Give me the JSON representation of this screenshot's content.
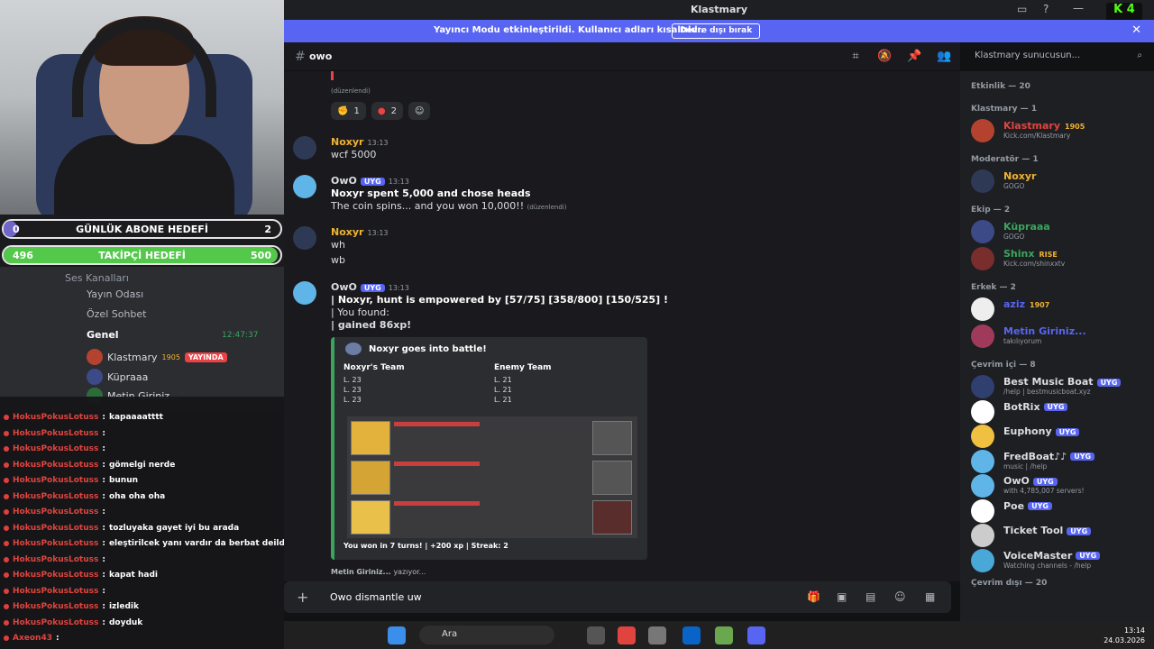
{
  "titlebar": {
    "title": "Klastmary"
  },
  "banner": {
    "text": "Yayıncı Modu etkinleştirildi. Kullanıcı adları kısaltıldı.",
    "button": "Devre dışı bırak"
  },
  "channel": {
    "name": "owo",
    "search_placeholder": "Klastmary sunucusun..."
  },
  "goals": {
    "sub": {
      "label": "GÜNLÜK ABONE HEDEFİ",
      "current": "0",
      "target": "2",
      "progress": 0.05
    },
    "follow": {
      "label": "TAKİPÇİ HEDEFİ",
      "current": "496",
      "target": "500",
      "progress": 0.99
    }
  },
  "left_discord": {
    "section": "Ses Kanalları",
    "channels": [
      "Yayın Odası",
      "Özel Sohbet",
      "Genel"
    ],
    "genel_time": "12:47:37",
    "voice_users": [
      {
        "name": "Klastmary",
        "badge": "1905",
        "live": "YAYINDA"
      },
      {
        "name": "Küpraaa"
      },
      {
        "name": "Metin Giriniz..."
      }
    ]
  },
  "chatlog": [
    {
      "user": "HokusPokusLotuss",
      "msg": "kapaaaatttt"
    },
    {
      "user": "HokusPokusLotuss",
      "msg": ""
    },
    {
      "user": "HokusPokusLotuss",
      "msg": ""
    },
    {
      "user": "HokusPokusLotuss",
      "msg": "gömelgi nerde"
    },
    {
      "user": "HokusPokusLotuss",
      "msg": "bunun"
    },
    {
      "user": "HokusPokusLotuss",
      "msg": "oha oha oha"
    },
    {
      "user": "HokusPokusLotuss",
      "msg": ""
    },
    {
      "user": "HokusPokusLotuss",
      "msg": "tozluyaka gayet iyi bu arada"
    },
    {
      "user": "HokusPokusLotuss",
      "msg": "eleştirilcek yanı vardır da berbat deildi"
    },
    {
      "user": "HokusPokusLotuss",
      "msg": ""
    },
    {
      "user": "HokusPokusLotuss",
      "msg": "kapat hadi"
    },
    {
      "user": "HokusPokusLotuss",
      "msg": ""
    },
    {
      "user": "HokusPokusLotuss",
      "msg": "izledik"
    },
    {
      "user": "HokusPokusLotuss",
      "msg": "doyduk"
    },
    {
      "user": "Axeon43",
      "msg": ""
    }
  ],
  "messages": {
    "edited": "(düzenlendi)",
    "reactions": [
      {
        "count": "1"
      },
      {
        "count": "2"
      }
    ],
    "m1": {
      "user": "Noxyr",
      "time": "13:13",
      "lines": [
        "wcf 5000"
      ]
    },
    "m2": {
      "user": "OwO",
      "tag": "UYG",
      "time": "13:13",
      "line1": "Noxyr spent 5,000 and chose heads",
      "line2": "The coin spins... and you won 10,000!!",
      "edited": "(düzenlendi)"
    },
    "m3": {
      "user": "Noxyr",
      "time": "13:13",
      "lines": [
        "wh",
        "wb"
      ]
    },
    "m4": {
      "user": "OwO",
      "tag": "UYG",
      "time": "13:13",
      "line1": "| Noxyr, hunt is empowered by [57/75] [358/800] [150/525] !",
      "line2": "| You found:",
      "line3": "| gained 86xp!"
    },
    "embed": {
      "title": "Noxyr goes into battle!",
      "team1": "Noxyr's Team",
      "team2": "Enemy Team",
      "team1_rows": [
        "L. 23",
        "L. 23",
        "L. 23"
      ],
      "team2_rows": [
        "L. 21",
        "L. 21",
        "L. 21"
      ],
      "footer": "You won in 7 turns! | +200 xp | Streak: 2"
    }
  },
  "typing": {
    "user": "Metin Giriniz...",
    "suffix": "yazıyor..."
  },
  "composer": {
    "value": "Owo dismantle uw"
  },
  "members": {
    "activity": "Etkinlik — 20",
    "groups": [
      {
        "role": "Klastmary — 1",
        "items": [
          {
            "name": "Klastmary",
            "sub": "Kick.com/Klastmary",
            "color": "#e0443f",
            "badge": "1905"
          }
        ]
      },
      {
        "role": "Moderatör — 1",
        "items": [
          {
            "name": "Noxyr",
            "sub": "GOGO",
            "color": "#f0b232"
          }
        ]
      },
      {
        "role": "Ekip — 2",
        "items": [
          {
            "name": "Küpraaa",
            "sub": "GOGO",
            "color": "#3ba55d"
          },
          {
            "name": "Shinx",
            "sub": "Kick.com/shinxxtv",
            "color": "#3ba55d",
            "badge": "RISE"
          }
        ]
      },
      {
        "role": "Erkek — 2",
        "items": [
          {
            "name": "aziz",
            "sub": "",
            "color": "#5865f2",
            "badge": "1907"
          },
          {
            "name": "Metin Giriniz...",
            "sub": "takılıyorum",
            "color": "#5865f2"
          }
        ]
      },
      {
        "role": "Çevrim içi — 8",
        "items": [
          {
            "name": "Best Music Boat",
            "sub": "/help | bestmusicboat.xyz",
            "color": "#dbdee1",
            "tag": "UYG"
          },
          {
            "name": "BotRix",
            "sub": "",
            "color": "#dbdee1",
            "tag": "UYG"
          },
          {
            "name": "Euphony",
            "sub": "",
            "color": "#dbdee1",
            "tag": "UYG"
          },
          {
            "name": "FredBoat♪♪",
            "sub": "music | /help",
            "color": "#dbdee1",
            "tag": "UYG"
          },
          {
            "name": "OwO",
            "sub": "with 4,785,007 servers!",
            "color": "#dbdee1",
            "tag": "UYG"
          },
          {
            "name": "Poe",
            "sub": "",
            "color": "#dbdee1",
            "tag": "UYG"
          },
          {
            "name": "Ticket Tool",
            "sub": "",
            "color": "#dbdee1",
            "tag": "UYG"
          },
          {
            "name": "VoiceMaster",
            "sub": "Watching channels - /help",
            "color": "#dbdee1",
            "tag": "UYG"
          }
        ]
      }
    ],
    "offline": "Çevrim dışı — 20"
  },
  "taskbar": {
    "search": "Ara",
    "time": "13:14",
    "date": "24.03.2026"
  },
  "colors": {
    "accent": "#5865f2",
    "brand_green": "#53fc18",
    "danger": "#ed4245"
  }
}
